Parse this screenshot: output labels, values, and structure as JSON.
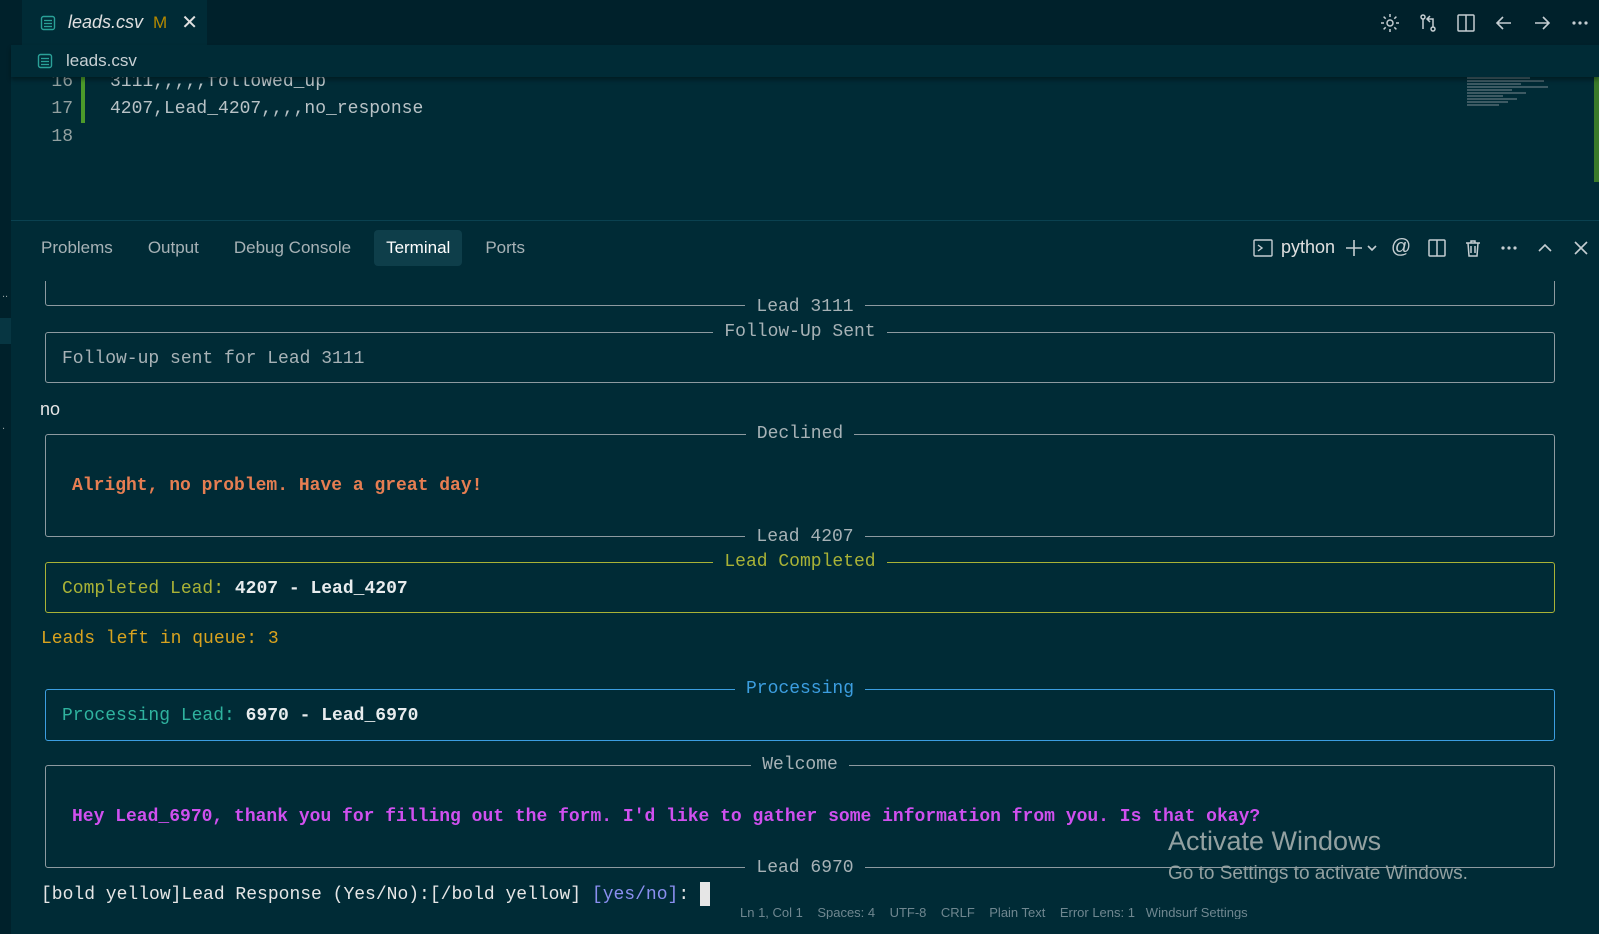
{
  "tab": {
    "title": "leads.csv",
    "modified": "M",
    "close": "✕"
  },
  "breadcrumb": {
    "file": "leads.csv"
  },
  "editor": {
    "lines": [
      {
        "num": "16",
        "text": "3111,,,,,followed_up"
      },
      {
        "num": "17",
        "text": "4207,Lead_4207,,,,no_response"
      },
      {
        "num": "18",
        "text": ""
      }
    ]
  },
  "panel": {
    "tabs": [
      "Problems",
      "Output",
      "Debug Console",
      "Terminal",
      "Ports"
    ],
    "active_tab": "Terminal",
    "terminal_name": "python"
  },
  "terminal": {
    "lead_3111_caption": "Lead 3111",
    "followup_title": "Follow-Up Sent",
    "followup_text": "Follow-up sent for Lead 3111",
    "user_input_no": "no",
    "declined_title": "Declined",
    "declined_text": "Alright, no problem. Have a great day!",
    "lead_4207_caption": "Lead 4207",
    "completed_title": "Lead Completed",
    "completed_label": "Completed Lead:",
    "completed_value": "4207 - Lead_4207",
    "queue_label": "Leads left in queue:",
    "queue_count": "3",
    "processing_title": "Processing",
    "processing_label": "Processing Lead:",
    "processing_value": "6970 - Lead_6970",
    "welcome_title": "Welcome",
    "welcome_text": "Hey Lead_6970, thank you for filling out the form. I'd like to gather some information from you. Is that okay?",
    "lead_6970_caption": "Lead 6970",
    "prompt_text": "[bold yellow]Lead Response (Yes/No):[/bold yellow]",
    "prompt_choices": "[yes/no]",
    "prompt_colon": ":"
  },
  "watermark": {
    "line1": "Activate Windows",
    "line2": "Go to Settings to activate Windows."
  },
  "statusbar": {
    "text": "Ln 1, Col 1    Spaces: 4    UTF-8    CRLF    Plain Text    Error Lens: 1   Windsurf Settings"
  },
  "colors": {
    "background": "#002b36",
    "accent_green": "#a9b236",
    "accent_blue": "#3c9ee0",
    "accent_magenta": "#d050ef",
    "accent_orange": "#e67e52"
  }
}
